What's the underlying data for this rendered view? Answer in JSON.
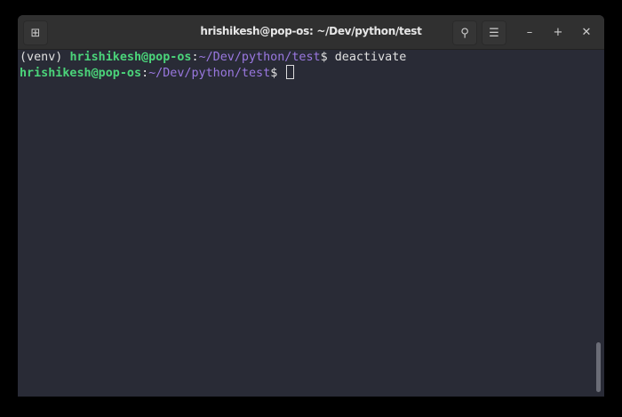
{
  "window": {
    "title": "hrishikesh@pop-os: ~/Dev/python/test"
  },
  "icons": {
    "new_tab": "new-tab-icon",
    "search": "search-icon",
    "menu": "hamburger-menu-icon",
    "minimize": "minimize-icon",
    "maximize": "maximize-icon",
    "close": "close-icon"
  },
  "terminal": {
    "lines": [
      {
        "prefix": "(venv) ",
        "user_host": "hrishikesh@pop-os",
        "sep": ":",
        "path": "~/Dev/python/test",
        "prompt": "$ ",
        "command": "deactivate"
      },
      {
        "user_host": "hrishikesh@pop-os",
        "sep": ":",
        "path": "~/Dev/python/test",
        "prompt": "$ "
      }
    ]
  },
  "colors": {
    "user": "#4bd47a",
    "path": "#9a78e0",
    "bg": "#292b36"
  }
}
